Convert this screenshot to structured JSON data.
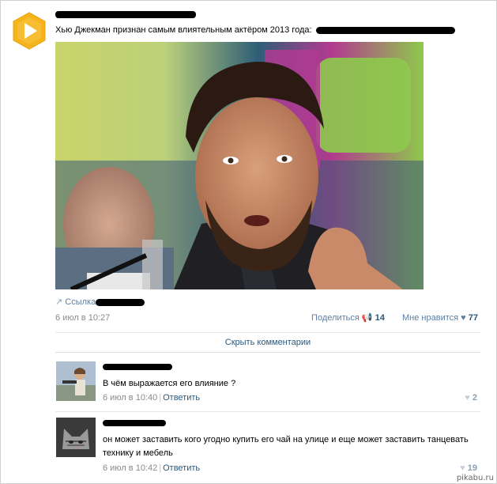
{
  "post": {
    "author_name_redacted": "",
    "text": "Хью Джекман признан самым влиятельным актёром 2013 года:",
    "link_label": "Ссылка",
    "date": "6 июл в 10:27",
    "share_label": "Поделиться",
    "share_count": "14",
    "like_label": "Мне нравится",
    "like_count": "77",
    "image_icon": "photo-of-man-at-press-conference"
  },
  "comments_toggle": "Скрыть комментарии",
  "comments": [
    {
      "text": "В чём выражается его влияние ?",
      "date": "6 июл в 10:40",
      "reply_label": "Ответить",
      "like_count": "2"
    },
    {
      "text": "он может заставить кого угодно купить его чай на улице и еще может заставить танцевать технику и мебель",
      "date": "6 июл в 10:42",
      "reply_label": "Ответить",
      "like_count": "19"
    }
  ],
  "watermark": "pikabu.ru",
  "colors": {
    "link": "#2b587a",
    "muted": "#8a8a8a",
    "logo": "#f5b31c"
  }
}
